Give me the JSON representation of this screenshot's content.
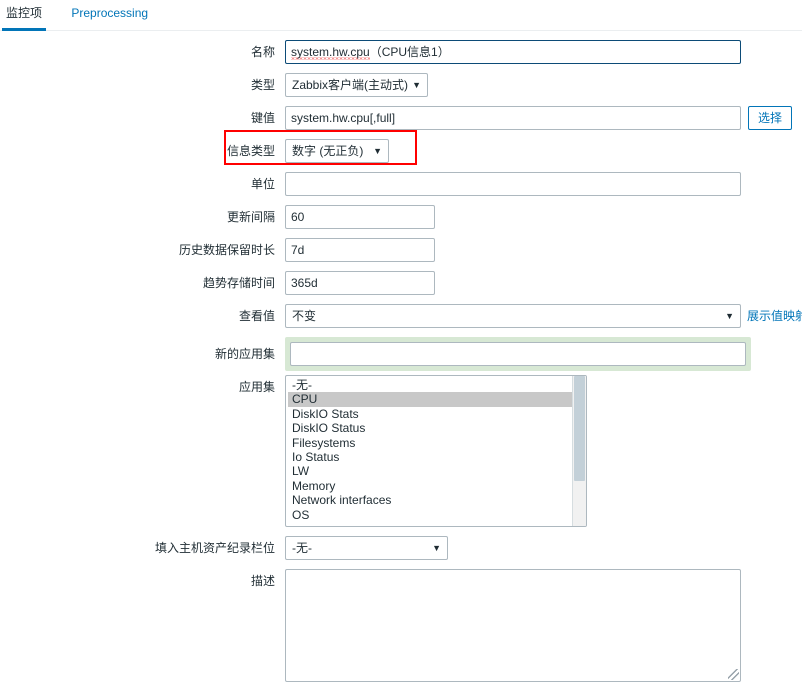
{
  "tabs": [
    {
      "label": "监控项",
      "active": true
    },
    {
      "label": "Preprocessing",
      "active": false
    }
  ],
  "form": {
    "name": {
      "label": "名称",
      "value_spell": "system.hw.cpu",
      "value_rest": "（CPU信息1）"
    },
    "type": {
      "label": "类型",
      "value": "Zabbix客户端(主动式)"
    },
    "key": {
      "label": "键值",
      "value": "system.hw.cpu[,full]",
      "select_button": "选择"
    },
    "info_type": {
      "label": "信息类型",
      "value": "数字 (无正负)"
    },
    "units": {
      "label": "单位",
      "value": ""
    },
    "update_interval": {
      "label": "更新间隔",
      "value": "60"
    },
    "history": {
      "label": "历史数据保留时长",
      "value": "7d"
    },
    "trends": {
      "label": "趋势存储时间",
      "value": "365d"
    },
    "show_value": {
      "label": "查看值",
      "value": "不变",
      "link": "展示值映射"
    },
    "new_application": {
      "label": "新的应用集",
      "value": "",
      "placeholder": ""
    },
    "applications": {
      "label": "应用集",
      "options": [
        "-无-",
        "CPU",
        "DiskIO Stats",
        "DiskIO Status",
        "Filesystems",
        "Io Status",
        "LW",
        "Memory",
        "Network interfaces",
        "OS"
      ],
      "selected": "CPU"
    },
    "inventory_field": {
      "label": "填入主机资产纪录栏位",
      "value": "-无-"
    },
    "description": {
      "label": "描述",
      "value": ""
    }
  },
  "annotation": {
    "color": "#ff0000",
    "target": "信息类型"
  },
  "colors": {
    "accent": "#0275b8",
    "annotation_red": "#ff0000",
    "focus_green": "#d7e8d4",
    "focus_blue": "#0c4b77",
    "selected_gray": "#c8c8c8"
  }
}
